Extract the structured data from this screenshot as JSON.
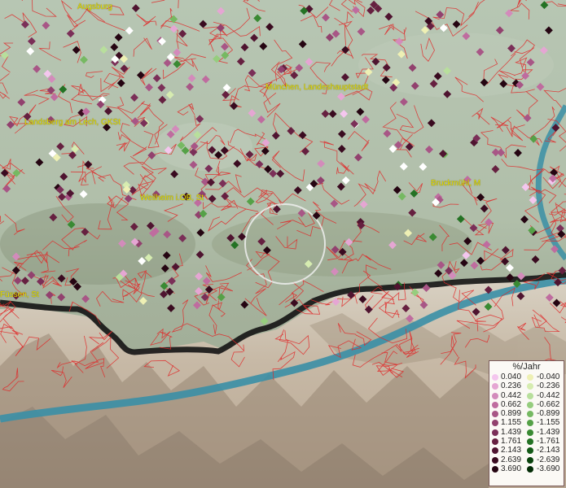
{
  "places": [
    {
      "name": "Augsburg"
    },
    {
      "name": "München, Landeshauptstadt"
    },
    {
      "name": "Landsberg am Lech, GKSt"
    },
    {
      "name": "Weilheim i.OB, St"
    },
    {
      "name": "Bruckmühl, M"
    },
    {
      "name": "Füssen, St"
    }
  ],
  "legend": {
    "title": "%/Jahr",
    "rows": [
      {
        "pos": "0.040",
        "neg": "-0.040",
        "pos_color": "#f4c6ee",
        "neg_color": "#eef0b4"
      },
      {
        "pos": "0.236",
        "neg": "-0.236",
        "pos_color": "#e5a6d3",
        "neg_color": "#d6ecb0"
      },
      {
        "pos": "0.442",
        "neg": "-0.442",
        "pos_color": "#d38bbb",
        "neg_color": "#b8df9c"
      },
      {
        "pos": "0.662",
        "neg": "-0.662",
        "pos_color": "#bf6c9f",
        "neg_color": "#96cd7e"
      },
      {
        "pos": "0.899",
        "neg": "-0.899",
        "pos_color": "#a85686",
        "neg_color": "#76b962"
      },
      {
        "pos": "1.155",
        "neg": "-1.155",
        "pos_color": "#92416e",
        "neg_color": "#55a147"
      },
      {
        "pos": "1.439",
        "neg": "-1.439",
        "pos_color": "#7b2f58",
        "neg_color": "#3a8a33"
      },
      {
        "pos": "1.761",
        "neg": "-1.761",
        "pos_color": "#662040",
        "neg_color": "#247224"
      },
      {
        "pos": "2.143",
        "neg": "-2.143",
        "pos_color": "#4f1430",
        "neg_color": "#145a17"
      },
      {
        "pos": "2.639",
        "neg": "-2.639",
        "pos_color": "#3a0b20",
        "neg_color": "#0a430d"
      },
      {
        "pos": "3.690",
        "neg": "-3.690",
        "pos_color": "#250512",
        "neg_color": "#032c06"
      }
    ]
  }
}
